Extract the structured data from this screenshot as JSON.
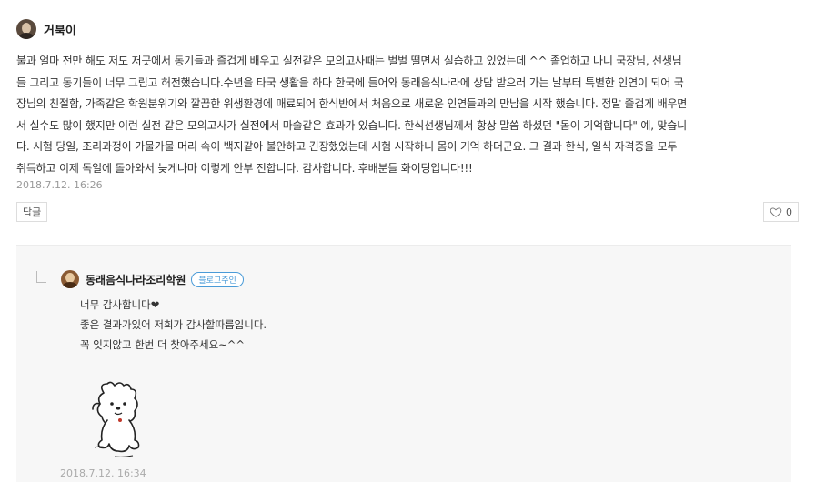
{
  "comment": {
    "author": "거북이",
    "lines": [
      "불과 얼마 전만 해도 저도 저곳에서 동기들과 즐겁게 배우고 실전같은 모의고사때는 벌벌 떨면서 실습하고 있었는데 ^^ 졸업하고 나니 국장님, 선생님",
      "들 그리고 동기들이 너무 그립고 허전했습니다.수년을 타국 생활을 하다 한국에 들어와 동래음식나라에 상담 받으러 가는 날부터 특별한 인연이 되어 국",
      "장님의 친절함, 가족같은 학원분위기와 깔끔한 위생환경에 매료되어 한식반에서 처음으로 새로운 인연들과의 만남을 시작 했습니다. 정말 즐겁게 배우면",
      "서 실수도 많이 했지만 이런 실전 같은 모의고사가 실전에서 마술같은 효과가 있습니다. 한식선생님께서 항상 말씀 하셨던 \"몸이 기억합니다\" 예, 맞습니",
      "다. 시험 당일, 조리과정이 가물가물 머리 속이 백지같아 불안하고 긴장했었는데 시험 시작하니 몸이 기억 하더군요. 그 결과 한식, 일식 자격증을 모두",
      "취득하고 이제 독일에 돌아와서 늦게나마 이렇게 안부 전합니다. 감사합니다. 후배분들 화이팅입니다!!!"
    ],
    "date": "2018.7.12. 16:26",
    "reply_button": "답글",
    "like_count": "0"
  },
  "reply": {
    "author": "동래음식나라조리학원",
    "badge": "블로그주인",
    "lines": [
      "너무 감사합니다❤",
      "좋은 결과가있어 저희가 감사할따름입니다.",
      "꼭 잊지않고 한번 더 찾아주세요~^^"
    ],
    "date": "2018.7.12. 16:34"
  },
  "colors": {
    "badge": "#4a9bd8",
    "reply_bg": "#f7f7f7"
  }
}
